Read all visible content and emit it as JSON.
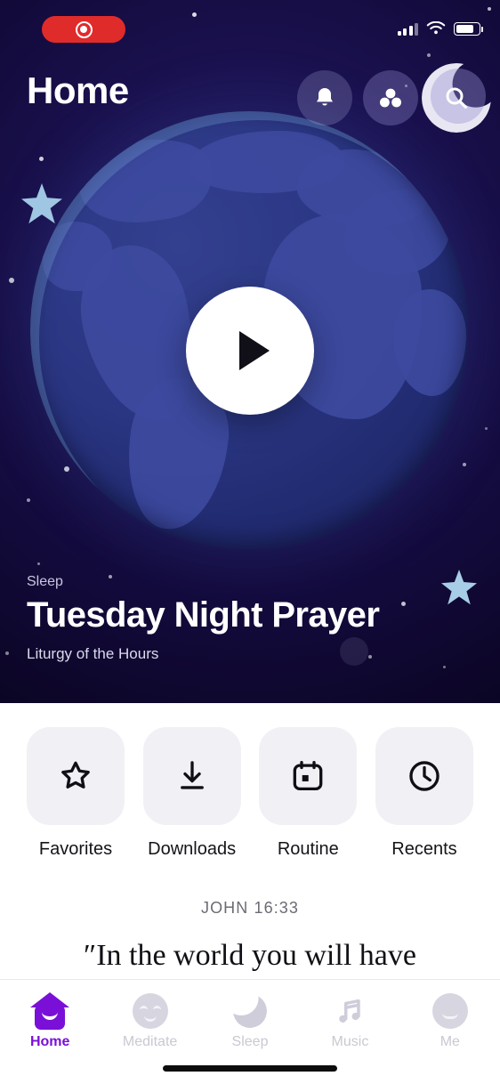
{
  "status_bar": {
    "recording_label": "record-indicator",
    "signal_icon": "cellular-signal-icon",
    "wifi_icon": "wifi-icon",
    "battery_icon": "battery-icon",
    "battery_level": "70%"
  },
  "header": {
    "title": "Home",
    "actions": [
      {
        "name": "notifications",
        "icon": "bell-icon"
      },
      {
        "name": "community",
        "icon": "groups-icon"
      },
      {
        "name": "search",
        "icon": "search-icon"
      }
    ]
  },
  "hero": {
    "eyebrow": "Sleep",
    "title": "Tuesday Night Prayer",
    "subtitle": "Liturgy of the Hours",
    "play_label": "play-button",
    "artwork": "earth-globe-illustration"
  },
  "quick_actions": [
    {
      "label": "Favorites",
      "icon": "star-icon"
    },
    {
      "label": "Downloads",
      "icon": "download-icon"
    },
    {
      "label": "Routine",
      "icon": "calendar-icon"
    },
    {
      "label": "Recents",
      "icon": "clock-icon"
    }
  ],
  "verse": {
    "reference": "JOHN 16:33",
    "text": "″In the world you will have"
  },
  "tabs": [
    {
      "label": "Home",
      "icon": "home-icon",
      "active": true
    },
    {
      "label": "Meditate",
      "icon": "sleepy-face-icon",
      "active": false
    },
    {
      "label": "Sleep",
      "icon": "moon-icon",
      "active": false
    },
    {
      "label": "Music",
      "icon": "music-note-icon",
      "active": false
    },
    {
      "label": "Me",
      "icon": "profile-face-icon",
      "active": false
    }
  ],
  "colors": {
    "accent": "#7A10D8",
    "hero_background": "#1B1251",
    "tile_background": "#F1F0F5",
    "record_red": "#E02B2B"
  }
}
